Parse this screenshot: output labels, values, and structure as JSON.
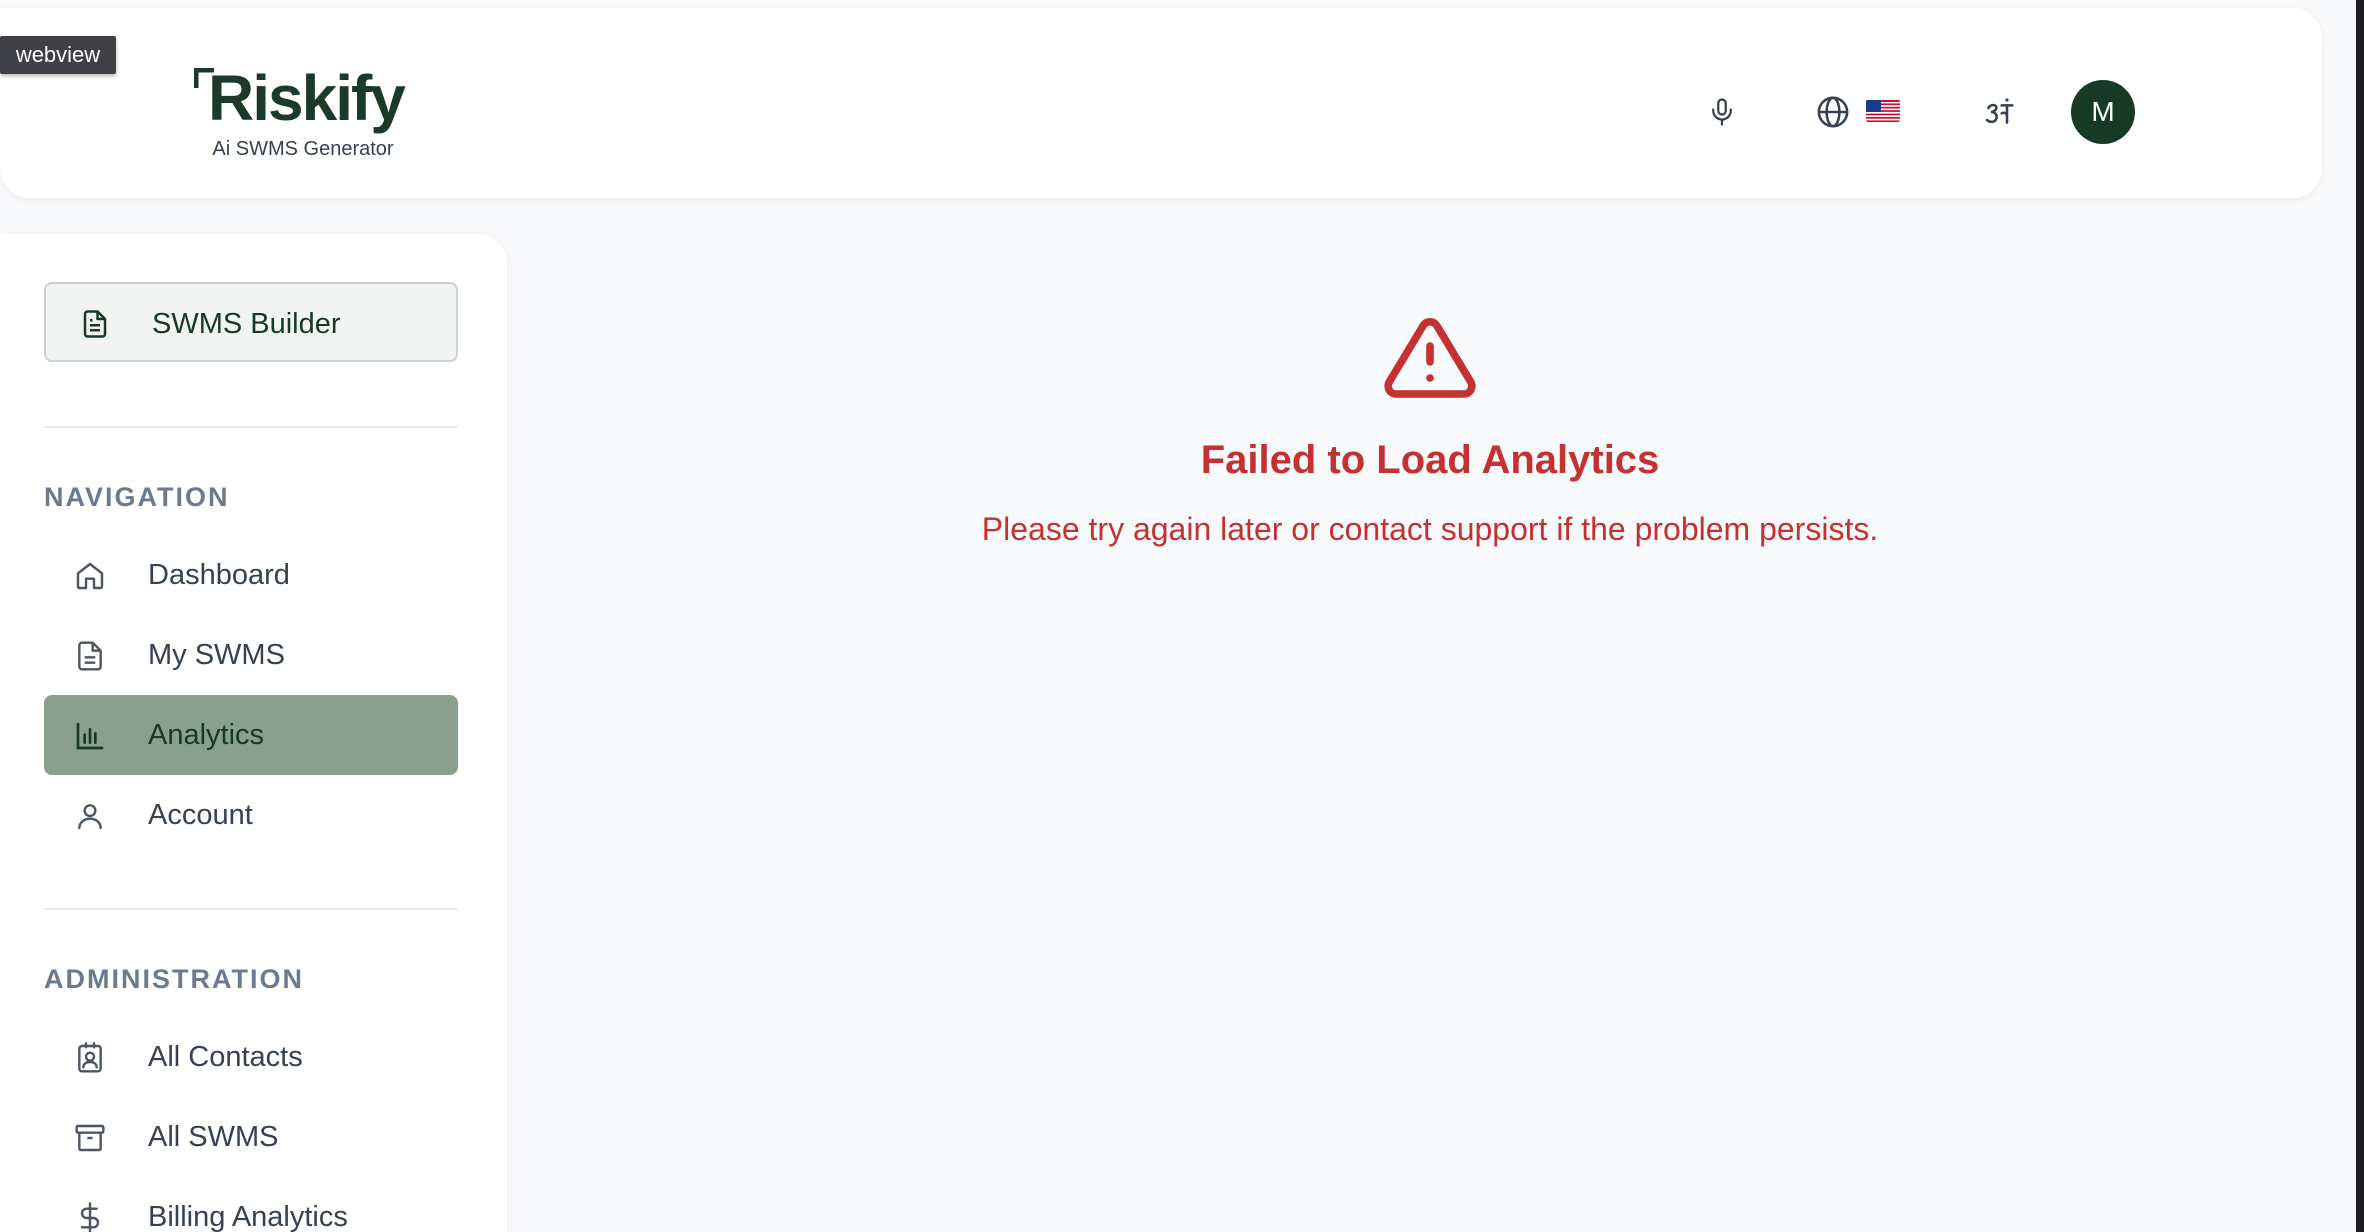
{
  "webview_tag": "webview",
  "header": {
    "logo_text": "Riskify",
    "logo_tagline": "Ai SWMS Generator",
    "avatar_initial": "M"
  },
  "sidebar": {
    "builder_label": "SWMS Builder",
    "navigation_title": "NAVIGATION",
    "nav_items": [
      {
        "label": "Dashboard",
        "icon": "home-icon",
        "active": false
      },
      {
        "label": "My SWMS",
        "icon": "document-icon",
        "active": false
      },
      {
        "label": "Analytics",
        "icon": "bar-chart-icon",
        "active": true
      },
      {
        "label": "Account",
        "icon": "user-icon",
        "active": false
      }
    ],
    "admin_title": "ADMINISTRATION",
    "admin_items": [
      {
        "label": "All Contacts",
        "icon": "contact-card-icon"
      },
      {
        "label": "All SWMS",
        "icon": "archive-icon"
      },
      {
        "label": "Billing Analytics",
        "icon": "dollar-icon"
      }
    ]
  },
  "main": {
    "error_title": "Failed to Load Analytics",
    "error_message": "Please try again later or contact support if the problem persists."
  },
  "colors": {
    "brand": "#163a24",
    "active_nav": "#8aa08e",
    "error": "#c53030"
  }
}
